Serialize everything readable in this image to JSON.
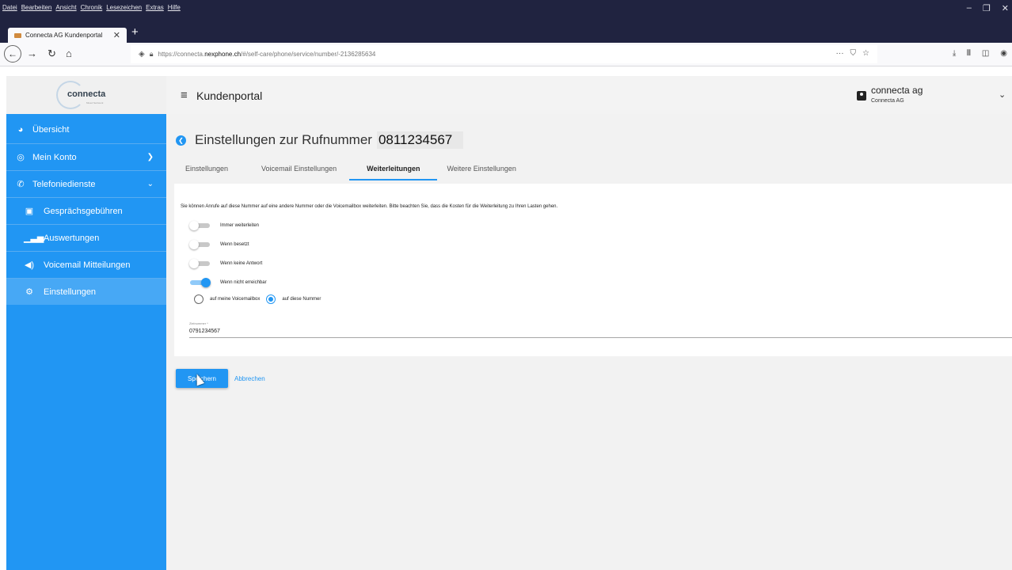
{
  "browser": {
    "menus": [
      "Datei",
      "Bearbeiten",
      "Ansicht",
      "Chronik",
      "Lesezeichen",
      "Extras",
      "Hilfe"
    ],
    "tab_title": "Connecta AG Kundenportal",
    "url_prefix": "https://connecta.",
    "url_domain": "nexphone.ch",
    "url_path": "/#/self-care/phone/service/number/-2136285634",
    "url_actions": "···"
  },
  "sidebar": {
    "logo_text": "connecta",
    "logo_tagline": "Mixed Netzwerk",
    "items": [
      {
        "label": "Übersicht",
        "icon": "dashboard-icon"
      },
      {
        "label": "Mein Konto",
        "icon": "account-circle-icon"
      },
      {
        "label": "Telefoniedienste",
        "icon": "phone-icon"
      },
      {
        "label": "Gesprächsgebühren",
        "icon": "receipt-icon"
      },
      {
        "label": "Auswertungen",
        "icon": "bar-chart-icon"
      },
      {
        "label": "Voicemail Mitteilungen",
        "icon": "speaker-icon"
      },
      {
        "label": "Einstellungen",
        "icon": "cogs-icon"
      }
    ]
  },
  "header": {
    "title": "Kundenportal",
    "account_name": "connecta ag",
    "account_sub": "Connecta AG"
  },
  "page": {
    "title": "Einstellungen zur Rufnummer",
    "number": "0811234567",
    "tabs": [
      "Einstellungen",
      "Voicemail Einstellungen",
      "Weiterleitungen",
      "Weitere Einstellungen"
    ],
    "active_tab": "Weiterleitungen"
  },
  "forwarding": {
    "intro": "Sie können Anrufe auf diese Nummer auf eine andere Nummer oder die Voicemailbox weiterleiten. Bitte beachten Sie, dass die Kosten für die Weiterleitung zu Ihren Lasten gehen.",
    "toggles": [
      {
        "label": "Immer weiterleiten",
        "on": false
      },
      {
        "label": "Wenn besetzt",
        "on": false
      },
      {
        "label": "Wenn keine Antwort",
        "on": false
      },
      {
        "label": "Wenn nicht erreichbar",
        "on": true
      }
    ],
    "radio_voicemail": "auf meine Voicemailbox",
    "radio_number": "auf diese Nummer",
    "selected": "auf diese Nummer",
    "target_label": "Zielnummer *",
    "target_value": "0791234567"
  },
  "actions": {
    "save": "Speichern",
    "cancel": "Abbrechen"
  },
  "colors": {
    "primary": "#2196f3",
    "sidebar_active": "#47a8f5",
    "titlebar": "#202340"
  }
}
